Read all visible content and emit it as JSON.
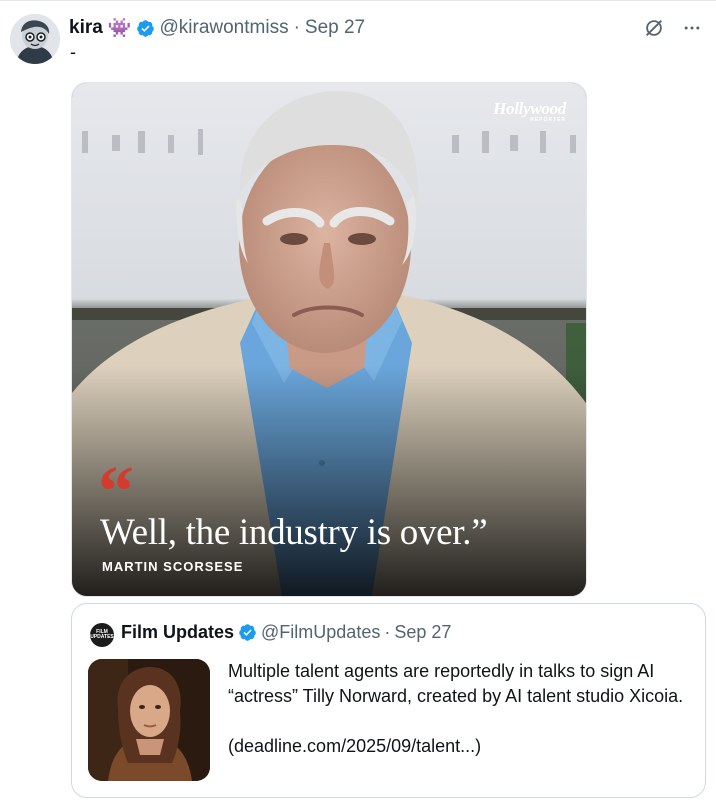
{
  "post": {
    "author": {
      "display_name": "kira",
      "emoji_badge": "👾",
      "handle": "@kirawontmiss",
      "verified": true
    },
    "separator": "·",
    "date": "Sep 27",
    "text": "-",
    "menu_icon": "more-horizontal-icon",
    "grok_icon": "grok-icon"
  },
  "media": {
    "brand": "Hollywood",
    "brand_sub": "REPORTER",
    "quote_mark": "“",
    "quote": "Well, the industry is over.”",
    "quote_author": "MARTIN SCORSESE",
    "accent_color": "#d33b2f"
  },
  "quoted_post": {
    "avatar_text": "FILM UPDATES",
    "display_name": "Film Updates",
    "verified": true,
    "handle": "@FilmUpdates",
    "separator": "·",
    "date": "Sep 27",
    "text": "Multiple talent agents are reportedly in talks to sign AI “actress” Tilly Norward, created by AI talent studio Xicoia.",
    "link": "(deadline.com/2025/09/talent...)"
  },
  "colors": {
    "verified_blue": "#1d9bf0",
    "secondary_text": "#536471",
    "border": "#cfd9de"
  }
}
